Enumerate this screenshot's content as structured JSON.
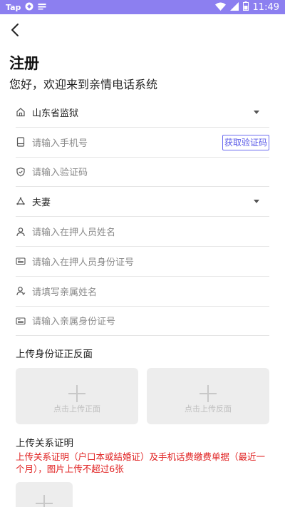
{
  "status_bar": {
    "carrier": "Tap",
    "time": "11:49",
    "icons": [
      "tap-logo-icon",
      "android-debug-icon",
      "sim-icon",
      "wifi-icon",
      "signal-icon",
      "battery-icon"
    ],
    "background_color": "#8c7ff0"
  },
  "nav": {
    "back_icon": "chevron-left-icon"
  },
  "header": {
    "title": "注册",
    "subtitle": "您好，欢迎来到亲情电话系统"
  },
  "form": {
    "prison": {
      "icon": "home-icon",
      "value": "山东省监狱"
    },
    "phone": {
      "icon": "phone-icon",
      "placeholder": "请输入手机号",
      "get_code_label": "获取验证码"
    },
    "code": {
      "icon": "shield-icon",
      "placeholder": "请输入验证码"
    },
    "relation": {
      "icon": "recycle-icon",
      "value": "夫妻"
    },
    "inmate_name": {
      "icon": "person-icon",
      "placeholder": "请输入在押人员姓名"
    },
    "inmate_id": {
      "icon": "id-card-icon",
      "placeholder": "请输入在押人员身份证号"
    },
    "relative_name": {
      "icon": "person-icon",
      "placeholder": "请填写亲属姓名"
    },
    "relative_id": {
      "icon": "id-card-icon",
      "placeholder": "请输入亲属身份证号"
    }
  },
  "id_upload": {
    "title": "上传身份证正反面",
    "front_label": "点击上传正面",
    "back_label": "点击上传反面"
  },
  "relation_upload": {
    "title": "上传关系证明",
    "notice": "上传关系证明（户口本或结婚证）及手机话费缴费单据（最近一个月），图片上传不超过6张",
    "notice_color": "#e02020"
  },
  "accent_color": "#5a5ae8"
}
